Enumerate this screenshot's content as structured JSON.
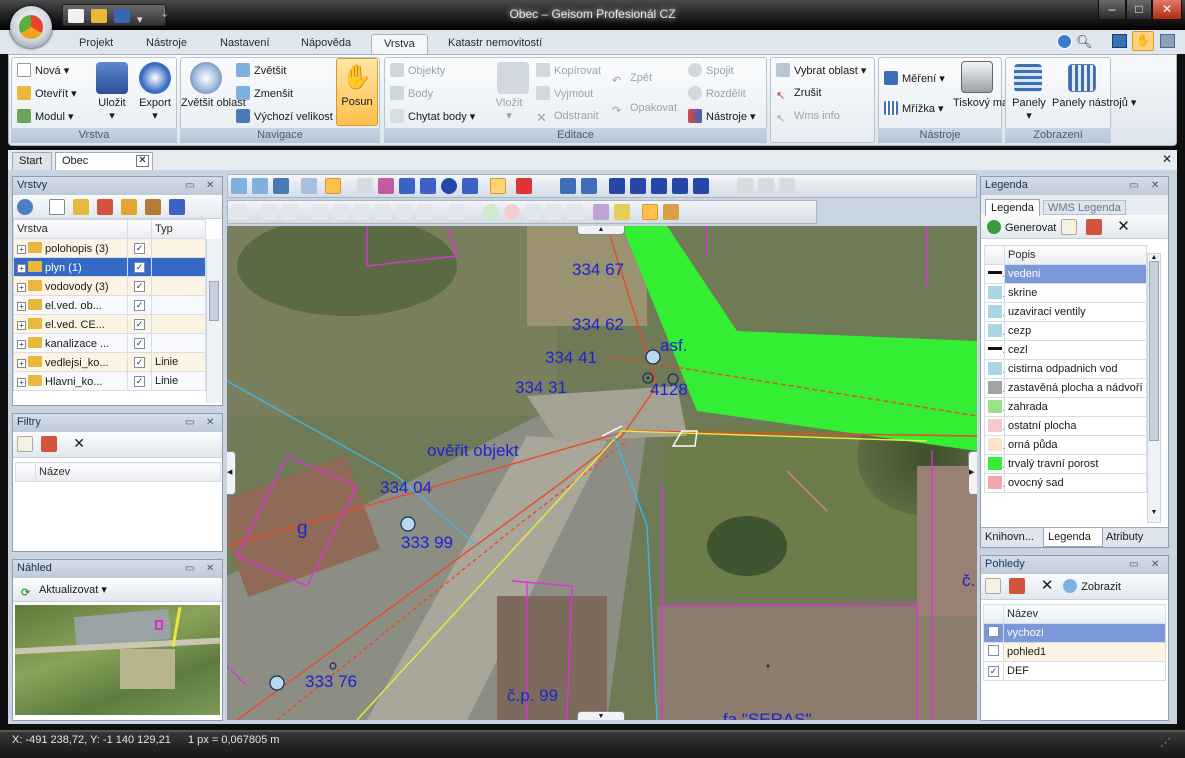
{
  "window": {
    "title": "Obec – Geisom Profesionál CZ",
    "buttons": [
      "–",
      "□",
      "✕"
    ]
  },
  "menu_tabs": [
    "Projekt",
    "Nástroje",
    "Nastavení",
    "Nápověda",
    "Vrstva",
    "Katastr nemovitostí"
  ],
  "active_tab": "Vrstva",
  "ribbon": {
    "vrstva": {
      "label": "Vrstva",
      "nova": "Nová",
      "otevrit": "Otevřít",
      "modul": "Modul",
      "ulozit": "Uložit",
      "export": "Export"
    },
    "navigace": {
      "label": "Navigace",
      "zvetsit_oblast": "Zvětšit oblast",
      "zvetsit": "Zvětšit",
      "zmensit": "Zmenšit",
      "vychozi": "Výchozí velikost",
      "posun": "Posun"
    },
    "editace": {
      "label": "Editace",
      "objekty": "Objekty",
      "body": "Body",
      "chytat": "Chytat body",
      "vlozit": "Vložit",
      "kopirovat": "Kopírovat",
      "vyjmout": "Vyjmout",
      "odstranit": "Odstranit",
      "zpet": "Zpět",
      "opakovat": "Opakovat",
      "spojit": "Spojit",
      "rozdelit": "Rozdělit",
      "nastroje": "Nástroje"
    },
    "vyber": {
      "vybrat": "Vybrat oblast",
      "zrusit": "Zrušit",
      "wms": "Wms info"
    },
    "nastroje": {
      "label": "Nástroje",
      "mereni": "Měření",
      "mrizka": "Mřížka",
      "tiskovy": "Tiskový manažer"
    },
    "zobrazeni": {
      "label": "Zobrazení",
      "panely": "Panely",
      "panely_nastroju": "Panely nástrojů"
    }
  },
  "doc_tabs": [
    "Start",
    "Obec"
  ],
  "layers_panel": {
    "title": "Vrstvy",
    "col_vrstva": "Vrstva",
    "col_typ": "Typ",
    "rows": [
      {
        "name": "polohopis (3)",
        "checked": true,
        "type": ""
      },
      {
        "name": "plyn (1)",
        "checked": true,
        "type": "",
        "selected": true
      },
      {
        "name": "vodovody (3)",
        "checked": true,
        "type": ""
      },
      {
        "name": "el.ved. ob...",
        "checked": true,
        "type": ""
      },
      {
        "name": "el.ved. CE...",
        "checked": true,
        "type": ""
      },
      {
        "name": "kanalizace ...",
        "checked": true,
        "type": ""
      },
      {
        "name": "vedlejsi_ko...",
        "checked": true,
        "type": "Linie"
      },
      {
        "name": "Hlavni_ko...",
        "checked": true,
        "type": "Linie"
      }
    ]
  },
  "filters_panel": {
    "title": "Filtry",
    "col_nazev": "Název"
  },
  "preview_panel": {
    "title": "Náhled",
    "refresh": "Aktualizovat"
  },
  "legend_panel": {
    "title": "Legenda",
    "tab_legend": "Legenda",
    "tab_wms": "WMS Legenda",
    "generate": "Generovat",
    "col_popis": "Popis",
    "items": [
      {
        "label": "vedeni",
        "color": "#111111",
        "selected": true
      },
      {
        "label": "skrine",
        "color": "#a8d6e3"
      },
      {
        "label": "uzaviraci ventily",
        "color": "#a8d6e3"
      },
      {
        "label": "cezp",
        "color": "#a8d6e3"
      },
      {
        "label": "cezl",
        "color": "#111111"
      },
      {
        "label": "cistirna odpadnich vod",
        "color": "#a8d6e3"
      },
      {
        "label": "zastavěná plocha a nádvoří",
        "color": "#a3a3a3"
      },
      {
        "label": "zahrada",
        "color": "#9be08a"
      },
      {
        "label": "ostatní plocha",
        "color": "#f6c9cf"
      },
      {
        "label": "orná půda",
        "color": "#fde3c8"
      },
      {
        "label": "trvalý travní porost",
        "color": "#35ee35"
      },
      {
        "label": "ovocný sad",
        "color": "#f4a6ad"
      }
    ],
    "bottom_tabs": [
      "Knihovn...",
      "Legenda",
      "Atributy"
    ]
  },
  "views_panel": {
    "title": "Pohledy",
    "show": "Zobrazit",
    "col_nazev": "Název",
    "rows": [
      {
        "name": "vychozi",
        "checked": false,
        "selected": true
      },
      {
        "name": "pohled1",
        "checked": false
      },
      {
        "name": "DEF",
        "checked": true
      }
    ]
  },
  "map_labels": [
    "334 67",
    "334 62",
    "334 41",
    "334 31",
    "asf.",
    "4128",
    "ověřit objekt",
    "334 04",
    "g",
    "333 99",
    "333 76",
    "č.p. 99",
    "fa \"SERAS\"",
    "č."
  ],
  "status": {
    "coords": "X: -491 238,72, Y: -1 140 129,21",
    "scale": "1 px = 0,067805 m"
  }
}
